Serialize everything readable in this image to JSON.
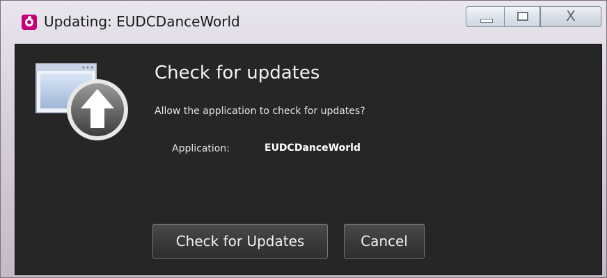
{
  "window": {
    "title": "Updating: EUDCDanceWorld",
    "controls": {
      "minimize": "",
      "maximize": "",
      "close": "X"
    }
  },
  "dialog": {
    "icon": "update-arrow-icon",
    "heading": "Check for updates",
    "question": "Allow the application to check for updates?",
    "application_label": "Application:",
    "application_name": "EUDCDanceWorld"
  },
  "buttons": {
    "check": "Check for Updates",
    "cancel": "Cancel"
  },
  "colors": {
    "dialog_bg": "#262626",
    "logo_accent": "#c4007a"
  }
}
